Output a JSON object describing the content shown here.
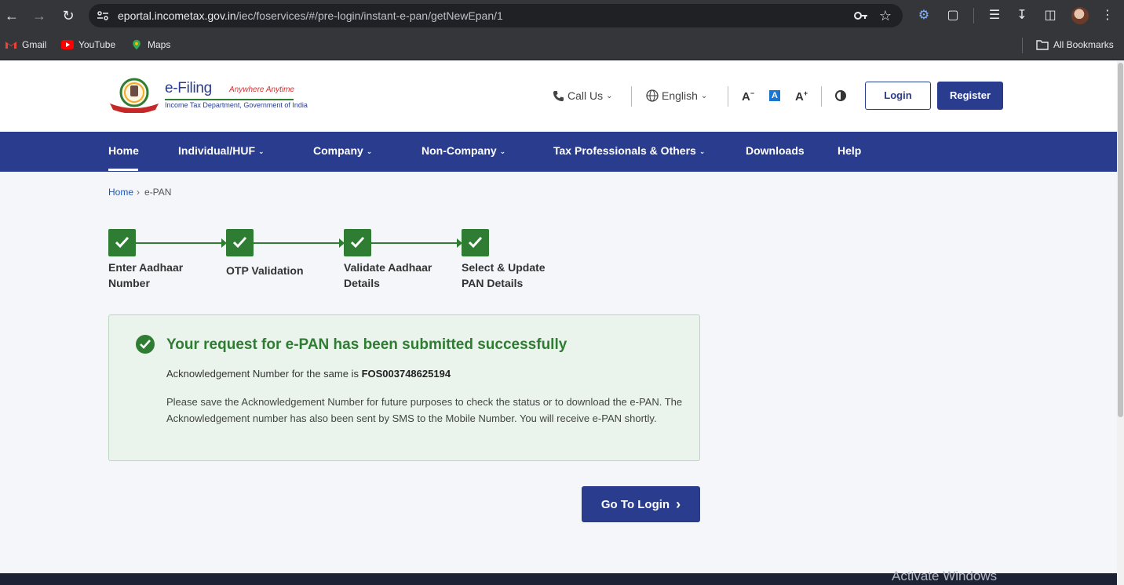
{
  "browser": {
    "url_host": "eportal.incometax.gov.in",
    "url_path": "/iec/foservices/#/pre-login/instant-e-pan/getNewEpan/1",
    "bookmarks": [
      "Gmail",
      "YouTube",
      "Maps"
    ],
    "all_bookmarks": "All Bookmarks"
  },
  "header": {
    "logo_title": "e-Filing",
    "logo_tagline": "Anywhere Anytime",
    "logo_subtitle": "Income Tax Department, Government of India",
    "call_us": "Call Us",
    "language": "English",
    "font_decrease": "A",
    "font_normal": "A",
    "font_increase": "A",
    "login": "Login",
    "register": "Register"
  },
  "nav": {
    "items": [
      {
        "label": "Home",
        "active": true
      },
      {
        "label": "Individual/HUF"
      },
      {
        "label": "Company"
      },
      {
        "label": "Non-Company"
      },
      {
        "label": "Tax Professionals & Others"
      },
      {
        "label": "Downloads"
      },
      {
        "label": "Help"
      }
    ]
  },
  "breadcrumb": {
    "home": "Home",
    "current": "e-PAN"
  },
  "steps": [
    {
      "line1": "Enter Aadhaar",
      "line2": "Number",
      "status": "done"
    },
    {
      "line1": "OTP Validation",
      "line2": "",
      "status": "done"
    },
    {
      "line1": "Validate Aadhaar",
      "line2": "Details",
      "status": "done"
    },
    {
      "line1": "Select & Update",
      "line2": "PAN Details",
      "status": "done"
    }
  ],
  "success": {
    "title": "Your request for e-PAN has been submitted successfully",
    "ack_prefix": "Acknowledgement Number for the same is ",
    "ack_number": "FOS003748625194",
    "body": "Please save the Acknowledgement Number for future purposes to check the status or to download the e-PAN. The Acknowledgement number has also been sent by SMS to the Mobile Number. You will receive e-PAN shortly."
  },
  "go_to_login": "Go To Login",
  "watermark": "Activate Windows",
  "colors": {
    "primary": "#2a3c8e",
    "success": "#2e7d32",
    "success_bg": "#eaf4ec"
  }
}
